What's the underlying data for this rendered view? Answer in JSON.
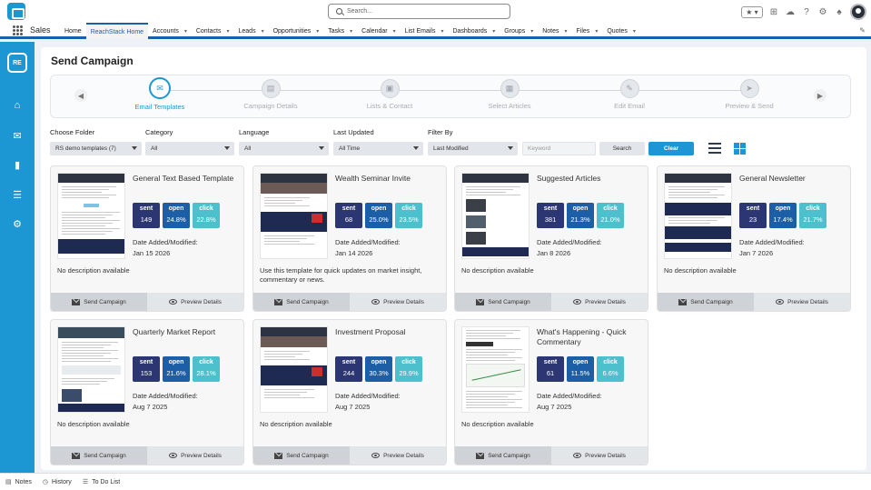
{
  "header": {
    "search_placeholder": "Search...",
    "fav_label": "★ ▾",
    "icons": [
      "plus-icon",
      "trailhead-icon",
      "help-icon",
      "settings-icon",
      "bell-icon"
    ]
  },
  "nav": {
    "app_name": "Sales",
    "items": [
      {
        "label": "Home",
        "chevron": false,
        "active": false
      },
      {
        "label": "ReachStack Home",
        "chevron": false,
        "active": true
      },
      {
        "label": "Accounts",
        "chevron": true,
        "active": false
      },
      {
        "label": "Contacts",
        "chevron": true,
        "active": false
      },
      {
        "label": "Leads",
        "chevron": true,
        "active": false
      },
      {
        "label": "Opportunities",
        "chevron": true,
        "active": false
      },
      {
        "label": "Tasks",
        "chevron": true,
        "active": false
      },
      {
        "label": "Calendar",
        "chevron": true,
        "active": false
      },
      {
        "label": "List Emails",
        "chevron": true,
        "active": false
      },
      {
        "label": "Dashboards",
        "chevron": true,
        "active": false
      },
      {
        "label": "Groups",
        "chevron": true,
        "active": false
      },
      {
        "label": "Notes",
        "chevron": true,
        "active": false
      },
      {
        "label": "Files",
        "chevron": true,
        "active": false
      },
      {
        "label": "Quotes",
        "chevron": true,
        "active": false
      }
    ]
  },
  "rail": {
    "logo_text": "RE",
    "icons": [
      "home-icon",
      "mail-icon",
      "chart-icon",
      "list-icon",
      "settings-icon"
    ]
  },
  "page": {
    "title": "Send Campaign",
    "steps": [
      {
        "label": "Email Templates",
        "icon": "✉",
        "active": true
      },
      {
        "label": "Campaign Details",
        "icon": "▤",
        "active": false
      },
      {
        "label": "Lists & Contact",
        "icon": "▣",
        "active": false
      },
      {
        "label": "Select Articles",
        "icon": "▦",
        "active": false
      },
      {
        "label": "Edit Email",
        "icon": "✎",
        "active": false
      },
      {
        "label": "Preview & Send",
        "icon": "➤",
        "active": false
      }
    ]
  },
  "filters": {
    "folder_label": "Choose Folder",
    "folder_value": "RS demo templates (7)",
    "category_label": "Category",
    "category_value": "All",
    "language_label": "Language",
    "language_value": "All",
    "updated_label": "Last Updated",
    "updated_value": "All Time",
    "filterby_label": "Filter By",
    "filterby_value": "Last Modified",
    "keyword_placeholder": "Keyword",
    "search_label": "Search",
    "clear_label": "Clear"
  },
  "card_labels": {
    "sent": "sent",
    "open": "open",
    "click": "click",
    "date_label": "Date Added/Modified:",
    "send_action": "Send Campaign",
    "preview_action": "Preview Details"
  },
  "cards": [
    {
      "title": "General Text Based Template",
      "sent": "149",
      "open": "24.8%",
      "click": "22.8%",
      "date": "Jan 15 2026",
      "description": "No description available",
      "thumb": "text"
    },
    {
      "title": "Wealth Seminar Invite",
      "sent": "68",
      "open": "25.0%",
      "click": "23.5%",
      "date": "Jan 14 2026",
      "description": "Use this template for quick updates on market insight, commentary or news.",
      "thumb": "seminar"
    },
    {
      "title": "Suggested Articles",
      "sent": "381",
      "open": "21.3%",
      "click": "21.0%",
      "date": "Jan 8 2026",
      "description": "No description available",
      "thumb": "articles"
    },
    {
      "title": "General Newsletter",
      "sent": "23",
      "open": "17.4%",
      "click": "21.7%",
      "date": "Jan 7 2026",
      "description": "No description available",
      "thumb": "newsletter"
    },
    {
      "title": "Quarterly Market Report",
      "sent": "153",
      "open": "21.6%",
      "click": "28.1%",
      "date": "Aug 7 2025",
      "description": "No description available",
      "thumb": "report"
    },
    {
      "title": "Investment Proposal",
      "sent": "244",
      "open": "30.3%",
      "click": "29.9%",
      "date": "Aug 7 2025",
      "description": "No description available",
      "thumb": "seminar"
    },
    {
      "title": "What's Happening - Quick Commentary",
      "sent": "61",
      "open": "11.5%",
      "click": "6.6%",
      "date": "Aug 7 2025",
      "description": "No description available",
      "thumb": "commentary"
    }
  ],
  "bottom": {
    "notes": "Notes",
    "history": "History",
    "todo": "To Do List"
  }
}
